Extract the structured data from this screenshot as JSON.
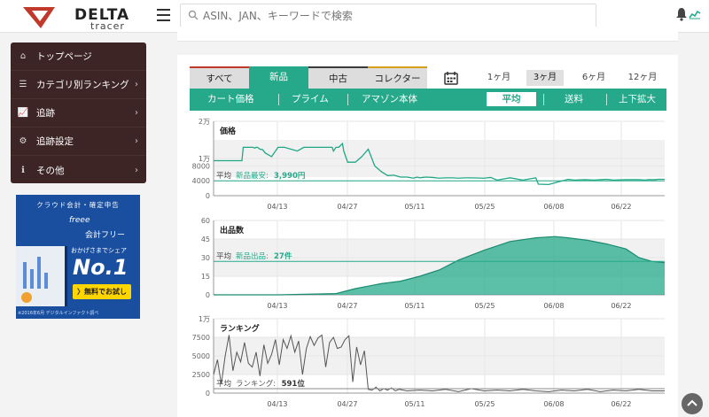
{
  "header": {
    "logo_text": "DELTA",
    "logo_sub": "tracer",
    "search_placeholder": "ASIN、JAN、キーワードで検索"
  },
  "sidebar": {
    "items": [
      {
        "label": "トップページ",
        "icon": "home-icon"
      },
      {
        "label": "カテゴリ別ランキング",
        "icon": "list-icon"
      },
      {
        "label": "追跡",
        "icon": "line-chart-icon"
      },
      {
        "label": "追跡設定",
        "icon": "gear-icon"
      },
      {
        "label": "その他",
        "icon": "info-icon"
      }
    ]
  },
  "ad": {
    "top": "クラウド会計・確定申告",
    "brand": "freee",
    "brand2": "会計フリー",
    "copy": "おかげさまでシェア",
    "no1": "No.1",
    "button": "〉無料でお試し",
    "foot": "※2016年6月 デジタルインファクト調べ"
  },
  "tabs": {
    "condition": [
      "すべて",
      "新品",
      "中古",
      "コレクター"
    ],
    "condition_active": "新品",
    "condition_accents": [
      "#c0392b",
      "#26a98a",
      "#3a3a3a",
      "#d4a017"
    ],
    "periods": [
      "1ヶ月",
      "3ヶ月",
      "6ヶ月",
      "12ヶ月"
    ],
    "period_active": "3ヶ月",
    "sub": [
      "カート価格",
      "プライム",
      "アマゾン本体",
      "平均",
      "送料",
      "上下拡大"
    ],
    "sub_active": "平均"
  },
  "colors": {
    "accent": "#26a98a",
    "sidebar": "#3d2525",
    "price_line": "#1fa784",
    "rank_line": "#555555"
  },
  "chart_data": [
    {
      "type": "line",
      "title": "価格",
      "x_ticks": [
        "04/13",
        "04/27",
        "05/11",
        "05/25",
        "06/08",
        "06/22"
      ],
      "y_ticks": [
        "2万",
        "1万",
        "8000",
        "4000",
        "0"
      ],
      "ylim": [
        0,
        20000
      ],
      "grid": true,
      "avg_label": "平均",
      "avg_text": "新品最安:",
      "avg_value": "3,990円",
      "avg_y": 3990,
      "series": [
        {
          "x": [
            0,
            4,
            22,
            23,
            30,
            30.5,
            32,
            33,
            34,
            36,
            38,
            40,
            45,
            50,
            55,
            65,
            70,
            80,
            88,
            92,
            93,
            95,
            97,
            100,
            101,
            103,
            104,
            110,
            115,
            120,
            125,
            130,
            135,
            140,
            145,
            150,
            155,
            158,
            160,
            162,
            165,
            170,
            175,
            180,
            185,
            190,
            195,
            200,
            210,
            215,
            220,
            230,
            240,
            250,
            252,
            260,
            275,
            280,
            288,
            295,
            300,
            305,
            310,
            320,
            330,
            335,
            337,
            339,
            342,
            345,
            348,
            350
          ],
          "y": [
            9400,
            9400,
            9400,
            13000,
            13000,
            13000,
            12800,
            13000,
            13000,
            12500,
            12400,
            11500,
            10500,
            13000,
            13000,
            12000,
            13000,
            13000,
            13000,
            13000,
            12000,
            13000,
            13000,
            14000,
            12000,
            10000,
            9000,
            9000,
            10500,
            12500,
            8000,
            6500,
            5400,
            5500,
            5000,
            5000,
            4700,
            5000,
            4800,
            4900,
            5000,
            4900,
            4700,
            4800,
            4800,
            4700,
            4800,
            4800,
            4700,
            4900,
            4200,
            4800,
            4200,
            4800,
            3100,
            3000,
            4400,
            4200,
            4300,
            4200,
            4300,
            4400,
            4200,
            4300,
            4300,
            4200,
            4300,
            4300,
            4300,
            4400,
            4400,
            4400
          ]
        }
      ]
    },
    {
      "type": "area",
      "title": "出品数",
      "x_ticks": [
        "04/13",
        "04/27",
        "05/11",
        "05/25",
        "06/08",
        "06/22"
      ],
      "y_ticks": [
        "60",
        "45",
        "30",
        "15",
        "0"
      ],
      "ylim": [
        0,
        60
      ],
      "grid": true,
      "avg_label": "平均",
      "avg_text": "新品出品:",
      "avg_value": "27件",
      "avg_y": 27,
      "series": [
        {
          "x": [
            0,
            50,
            95,
            110,
            120,
            130,
            145,
            160,
            175,
            190,
            210,
            230,
            250,
            265,
            275,
            290,
            305,
            320,
            330,
            340,
            350
          ],
          "y": [
            0,
            0,
            1,
            5,
            7,
            9,
            11,
            15,
            20,
            28,
            36,
            43,
            46,
            47,
            46,
            44,
            41,
            37,
            30,
            27,
            26
          ]
        }
      ]
    },
    {
      "type": "line",
      "title": "ランキング",
      "x_ticks": [
        "04/13",
        "04/27",
        "05/11",
        "05/25",
        "06/08",
        "06/22"
      ],
      "y_ticks": [
        "1万",
        "7500",
        "5000",
        "2500",
        "0"
      ],
      "ylim": [
        0,
        10000
      ],
      "grid": true,
      "avg_label": "平均",
      "avg_text": "ランキング:",
      "avg_value": "591位",
      "avg_y": 591,
      "series": [
        {
          "x": [
            0,
            3,
            6,
            9,
            12,
            15,
            18,
            21,
            24,
            27,
            30,
            33,
            36,
            39,
            42,
            45,
            48,
            51,
            54,
            57,
            60,
            63,
            66,
            69,
            72,
            75,
            78,
            81,
            84,
            87,
            90,
            93,
            96,
            99,
            102,
            105,
            108,
            111,
            114,
            117,
            120,
            123,
            126,
            129,
            132,
            135,
            138,
            141,
            144,
            150,
            160,
            170,
            180,
            190,
            200,
            210,
            220,
            230,
            240,
            250,
            260,
            270,
            280,
            290,
            300,
            310,
            320,
            330,
            340,
            350
          ],
          "y": [
            2500,
            4500,
            1200,
            5000,
            7800,
            3000,
            5500,
            4200,
            6800,
            4000,
            3500,
            5500,
            2300,
            6500,
            4000,
            5200,
            7200,
            3800,
            7200,
            6000,
            7700,
            5500,
            7000,
            2500,
            6000,
            7600,
            6400,
            7400,
            7800,
            3500,
            6800,
            7500,
            6000,
            6200,
            7200,
            7700,
            1500,
            6200,
            3800,
            5700,
            500,
            400,
            800,
            300,
            600,
            400,
            700,
            300,
            500,
            300,
            400,
            300,
            500,
            200,
            600,
            300,
            400,
            300,
            500,
            300,
            200,
            400,
            300,
            500,
            200,
            400,
            300,
            500,
            300,
            300
          ]
        }
      ]
    }
  ]
}
